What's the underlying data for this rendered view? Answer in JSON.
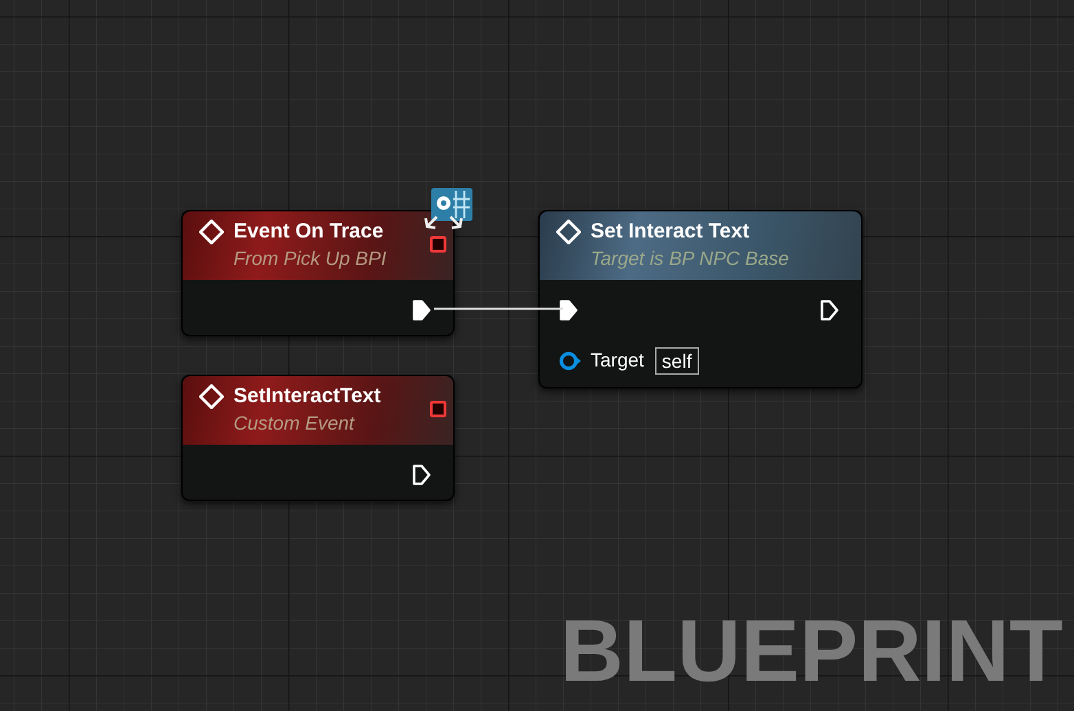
{
  "nodes": [
    {
      "kind": "event",
      "title": "Event On Trace",
      "subtitle": "From Pick Up BPI",
      "badge": true,
      "pins": [
        {
          "kind": "delegate"
        },
        {
          "kind": "exec_out",
          "connected": true
        }
      ]
    },
    {
      "kind": "event",
      "title": "SetInteractText",
      "subtitle": "Custom Event",
      "badge": false,
      "pins": [
        {
          "kind": "delegate"
        },
        {
          "kind": "exec_out",
          "connected": false
        }
      ]
    },
    {
      "kind": "function",
      "title": "Set Interact Text",
      "subtitle": "Target is BP NPC Base",
      "badge": false,
      "pins": [
        {
          "kind": "exec_in",
          "connected": true
        },
        {
          "kind": "exec_out",
          "connected": false
        },
        {
          "kind": "object_in",
          "connected": false,
          "label": "Target",
          "value": "self"
        }
      ]
    }
  ],
  "watermark": "BLUEPRINT"
}
